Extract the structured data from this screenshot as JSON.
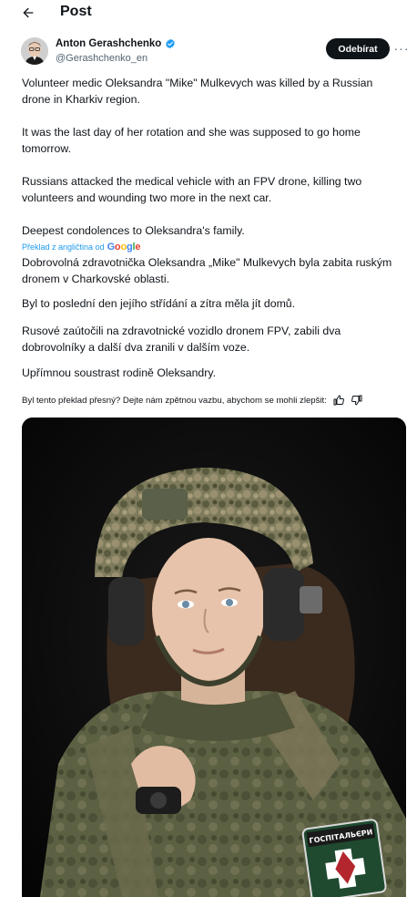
{
  "header": {
    "title": "Post"
  },
  "author": {
    "name": "Anton Gerashchenko",
    "handle": "@Gerashchenko_en"
  },
  "follow_label": "Odebírat",
  "more_label": "···",
  "post": {
    "p1": "Volunteer medic Oleksandra \"Mike\" Mulkevych was killed by a Russian drone in Kharkiv region.",
    "p2": "It was the last day of her rotation and she was supposed to go home tomorrow.",
    "p3": "Russians attacked the medical vehicle with an FPV drone, killing two volunteers and wounding two more in the next car.",
    "p4": "Deepest condolences to Oleksandra's family."
  },
  "translation": {
    "label": "Překlad z angličtina od",
    "p1": "Dobrovolná zdravotnička Oleksandra „Mike\" Mulkevych byla zabita ruským dronem v Charkovské oblasti.",
    "p2": "Byl to poslední den jejího střídání a zítra měla jít domů.",
    "p3": "Rusové zaútočili na zdravotnické vozidlo dronem FPV, zabili dva dobrovolníky a další dva zranili v dalším voze.",
    "p4": "Upřímnou soustrast rodině Oleksandry."
  },
  "feedback": {
    "question": "Byl tento překlad přesný? Dejte nám zpětnou vazbu, abychom se mohli zlepšit:"
  },
  "photo": {
    "patch_text": "ГОСПІТАЛЬЄРИ"
  },
  "colors": {
    "link": "#1d9bf0",
    "text": "#0f1419",
    "muted": "#536471",
    "verified": "#1d9bf0"
  },
  "icons": [
    "back-arrow-icon",
    "verified-badge-icon",
    "more-icon",
    "thumbs-up-icon",
    "thumbs-down-icon"
  ]
}
